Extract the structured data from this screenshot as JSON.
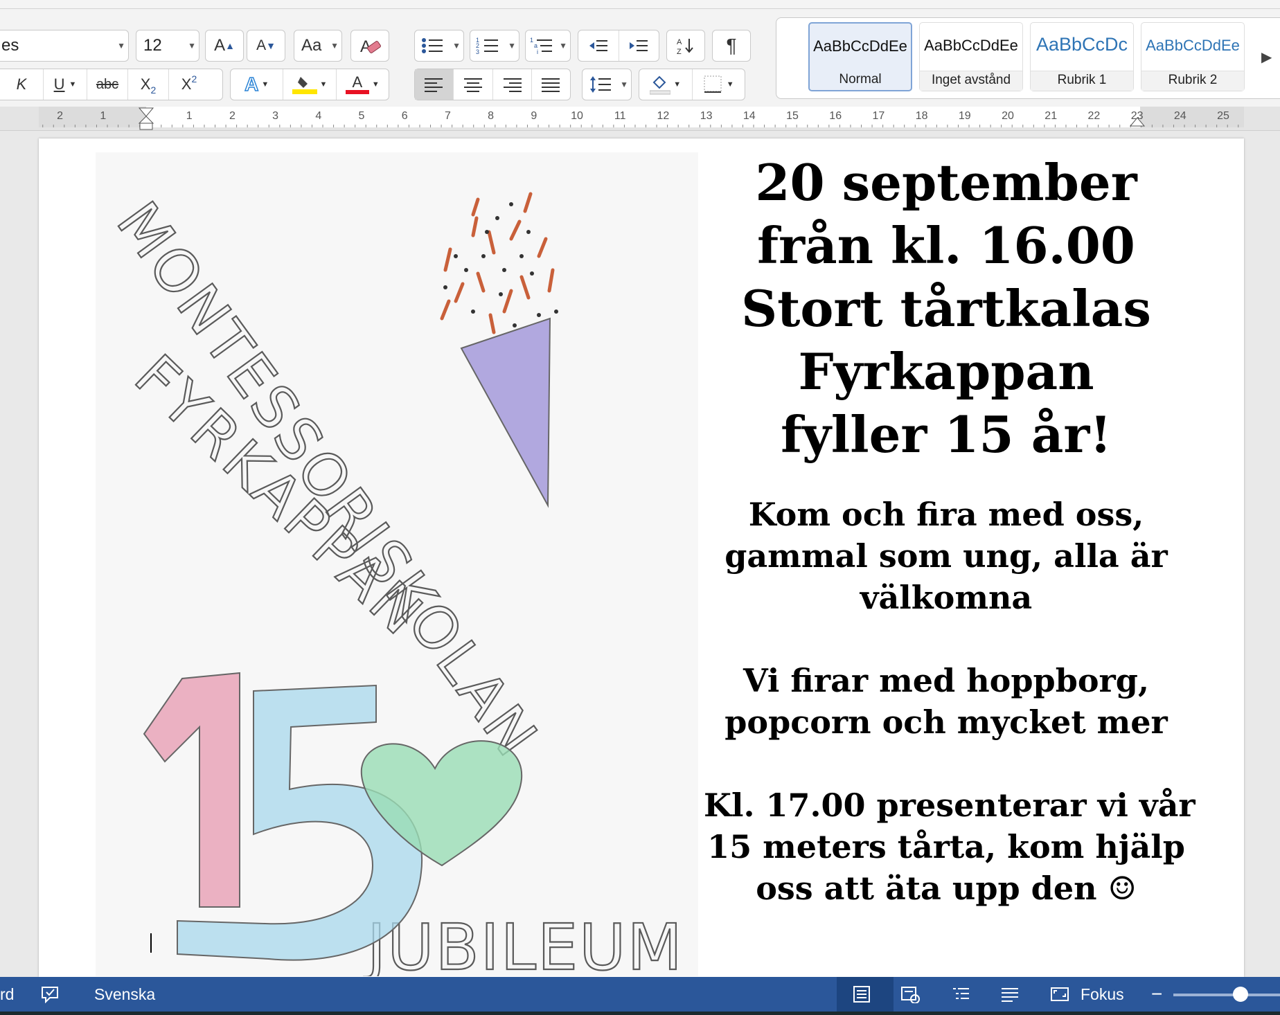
{
  "ribbon": {
    "font_name": "es",
    "font_size": "12",
    "grow_label": "A",
    "shrink_label": "A",
    "change_case_label": "Aa",
    "italic_label": "K",
    "underline_label": "U",
    "strike_label": "abc",
    "subscript_label": "X",
    "subscript_sub": "2",
    "superscript_label": "X",
    "superscript_sup": "2",
    "text_effects_label": "A",
    "font_color_label": "A",
    "pilcrow_label": "¶",
    "highlight_color": "#ffe600",
    "font_color": "#e81123",
    "accent": "#2b579a"
  },
  "styles": [
    {
      "sample": "AaBbCcDdEe",
      "name": "Normal"
    },
    {
      "sample": "AaBbCcDdEe",
      "name": "Inget avstånd"
    },
    {
      "sample": "AaBbCcDc",
      "name": "Rubrik 1"
    },
    {
      "sample": "AaBbCcDdEe",
      "name": "Rubrik 2"
    }
  ],
  "ruler": {
    "left_labels": [
      "2",
      "1"
    ],
    "labels": [
      "1",
      "2",
      "3",
      "4",
      "5",
      "6",
      "7",
      "8",
      "9",
      "10",
      "11",
      "12",
      "13",
      "14",
      "15",
      "16",
      "17",
      "18",
      "19",
      "20",
      "21",
      "22",
      "23",
      "24",
      "25"
    ]
  },
  "document": {
    "drawing": {
      "title_1": "MONTESSORISKOLAN",
      "title_2": "FYRKAPPAN",
      "digit_1": "1",
      "digit_5": "5",
      "bottom": "JUBILEUM",
      "colors": {
        "one": "#e79ab0",
        "five": "#a8d8ec",
        "heart": "#98dcb4",
        "cone": "#9f93d8",
        "sprinkles": "#c9603a"
      }
    },
    "headline": [
      "20 september",
      "från kl. 16.00",
      "Stort tårtkalas",
      "Fyrkappan",
      "fyller 15 år!"
    ],
    "paragraph_1": [
      "Kom och fira med oss,",
      "gammal som ung, alla är",
      "välkomna"
    ],
    "paragraph_2": [
      "Vi firar med hoppborg,",
      "popcorn och mycket mer"
    ],
    "paragraph_3": [
      "Kl. 17.00 presenterar vi vår",
      "15 meters tårta, kom hjälp",
      "oss att äta upp den ☺"
    ]
  },
  "statusbar": {
    "left_cut": "rd",
    "language": "Svenska",
    "focus": "Fokus"
  }
}
